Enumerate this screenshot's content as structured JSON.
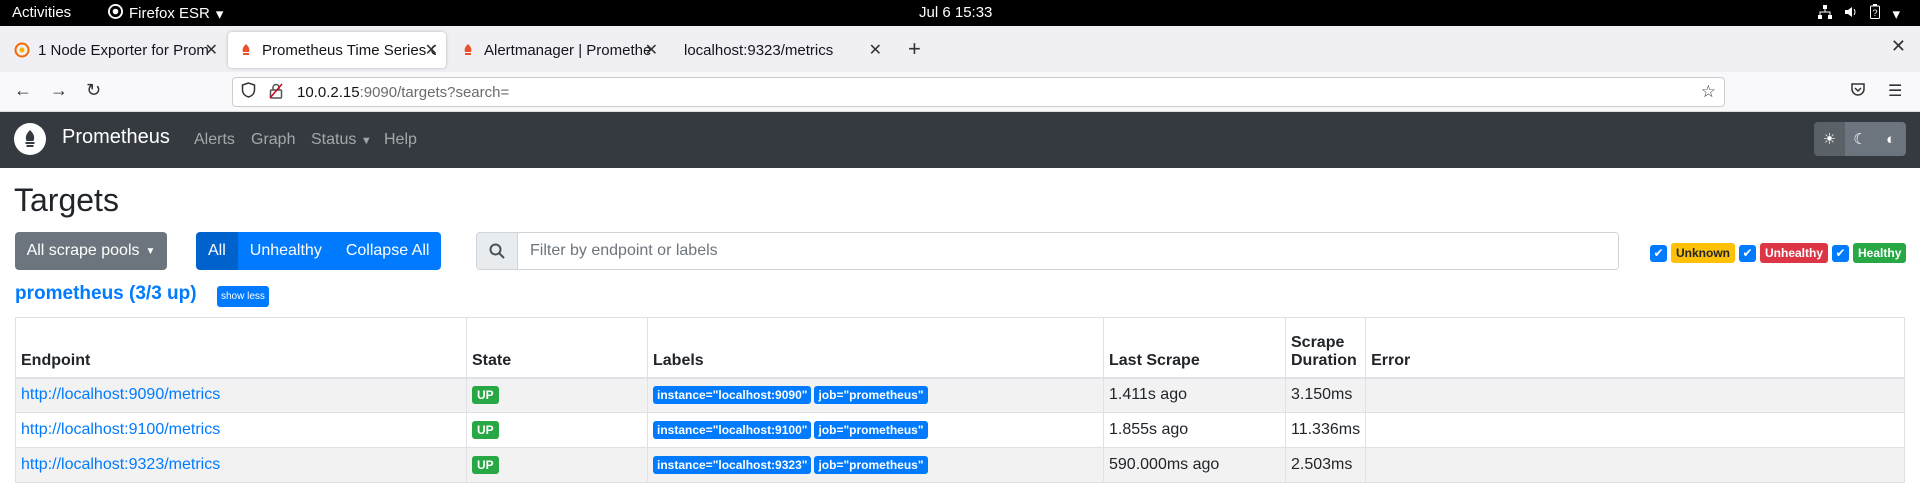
{
  "system": {
    "activities": "Activities",
    "app_name": "Firefox ESR",
    "clock": "Jul 6  15:33"
  },
  "tabs": [
    {
      "title": "1 Node Exporter for Prom",
      "active": false
    },
    {
      "title": "Prometheus Time Series C",
      "active": true
    },
    {
      "title": "Alertmanager | Promethe",
      "active": false
    },
    {
      "title": "localhost:9323/metrics",
      "active": false
    }
  ],
  "url": {
    "host": "10.0.2.15",
    "path": ":9090/targets?search="
  },
  "prometheus": {
    "brand": "Prometheus",
    "nav": [
      "Alerts",
      "Graph",
      "Status",
      "Help"
    ]
  },
  "page": {
    "title": "Targets",
    "pools_button": "All scrape pools",
    "filter_buttons": [
      "All",
      "Unhealthy",
      "Collapse All"
    ],
    "search_placeholder": "Filter by endpoint or labels",
    "health_filters": [
      {
        "label": "Unknown",
        "color": "#ffc107",
        "text_color": "#212529",
        "checked": true
      },
      {
        "label": "Unhealthy",
        "color": "#dc3545",
        "text_color": "#ffffff",
        "checked": true
      },
      {
        "label": "Healthy",
        "color": "#28a745",
        "text_color": "#ffffff",
        "checked": true
      }
    ]
  },
  "pool": {
    "title": "prometheus (3/3 up)",
    "toggle": "show less",
    "columns": [
      "Endpoint",
      "State",
      "Labels",
      "Last Scrape",
      "Scrape Duration",
      "Error"
    ],
    "rows": [
      {
        "endpoint": "http://localhost:9090/metrics",
        "state": "UP",
        "labels": [
          "instance=\"localhost:9090\"",
          "job=\"prometheus\""
        ],
        "last_scrape": "1.411s ago",
        "duration": "3.150ms",
        "error": ""
      },
      {
        "endpoint": "http://localhost:9100/metrics",
        "state": "UP",
        "labels": [
          "instance=\"localhost:9100\"",
          "job=\"prometheus\""
        ],
        "last_scrape": "1.855s ago",
        "duration": "11.336ms",
        "error": ""
      },
      {
        "endpoint": "http://localhost:9323/metrics",
        "state": "UP",
        "labels": [
          "instance=\"localhost:9323\"",
          "job=\"prometheus\""
        ],
        "last_scrape": "590.000ms ago",
        "duration": "2.503ms",
        "error": ""
      }
    ]
  }
}
